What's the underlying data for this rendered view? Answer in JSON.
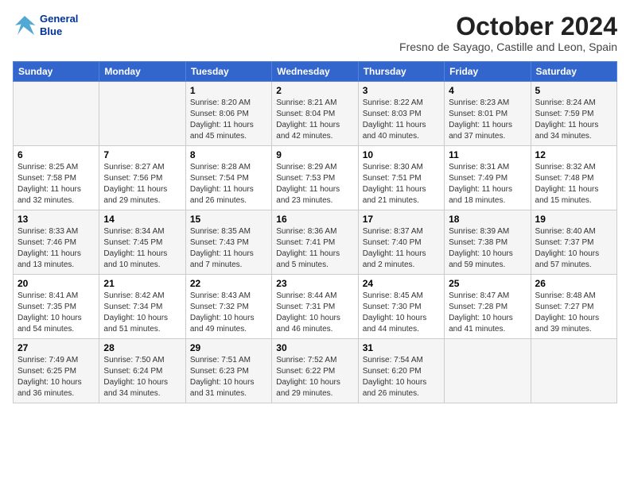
{
  "header": {
    "logo_line1": "General",
    "logo_line2": "Blue",
    "month_title": "October 2024",
    "subtitle": "Fresno de Sayago, Castille and Leon, Spain"
  },
  "days_of_week": [
    "Sunday",
    "Monday",
    "Tuesday",
    "Wednesday",
    "Thursday",
    "Friday",
    "Saturday"
  ],
  "weeks": [
    [
      {
        "day": "",
        "info": ""
      },
      {
        "day": "",
        "info": ""
      },
      {
        "day": "1",
        "info": "Sunrise: 8:20 AM\nSunset: 8:06 PM\nDaylight: 11 hours and 45 minutes."
      },
      {
        "day": "2",
        "info": "Sunrise: 8:21 AM\nSunset: 8:04 PM\nDaylight: 11 hours and 42 minutes."
      },
      {
        "day": "3",
        "info": "Sunrise: 8:22 AM\nSunset: 8:03 PM\nDaylight: 11 hours and 40 minutes."
      },
      {
        "day": "4",
        "info": "Sunrise: 8:23 AM\nSunset: 8:01 PM\nDaylight: 11 hours and 37 minutes."
      },
      {
        "day": "5",
        "info": "Sunrise: 8:24 AM\nSunset: 7:59 PM\nDaylight: 11 hours and 34 minutes."
      }
    ],
    [
      {
        "day": "6",
        "info": "Sunrise: 8:25 AM\nSunset: 7:58 PM\nDaylight: 11 hours and 32 minutes."
      },
      {
        "day": "7",
        "info": "Sunrise: 8:27 AM\nSunset: 7:56 PM\nDaylight: 11 hours and 29 minutes."
      },
      {
        "day": "8",
        "info": "Sunrise: 8:28 AM\nSunset: 7:54 PM\nDaylight: 11 hours and 26 minutes."
      },
      {
        "day": "9",
        "info": "Sunrise: 8:29 AM\nSunset: 7:53 PM\nDaylight: 11 hours and 23 minutes."
      },
      {
        "day": "10",
        "info": "Sunrise: 8:30 AM\nSunset: 7:51 PM\nDaylight: 11 hours and 21 minutes."
      },
      {
        "day": "11",
        "info": "Sunrise: 8:31 AM\nSunset: 7:49 PM\nDaylight: 11 hours and 18 minutes."
      },
      {
        "day": "12",
        "info": "Sunrise: 8:32 AM\nSunset: 7:48 PM\nDaylight: 11 hours and 15 minutes."
      }
    ],
    [
      {
        "day": "13",
        "info": "Sunrise: 8:33 AM\nSunset: 7:46 PM\nDaylight: 11 hours and 13 minutes."
      },
      {
        "day": "14",
        "info": "Sunrise: 8:34 AM\nSunset: 7:45 PM\nDaylight: 11 hours and 10 minutes."
      },
      {
        "day": "15",
        "info": "Sunrise: 8:35 AM\nSunset: 7:43 PM\nDaylight: 11 hours and 7 minutes."
      },
      {
        "day": "16",
        "info": "Sunrise: 8:36 AM\nSunset: 7:41 PM\nDaylight: 11 hours and 5 minutes."
      },
      {
        "day": "17",
        "info": "Sunrise: 8:37 AM\nSunset: 7:40 PM\nDaylight: 11 hours and 2 minutes."
      },
      {
        "day": "18",
        "info": "Sunrise: 8:39 AM\nSunset: 7:38 PM\nDaylight: 10 hours and 59 minutes."
      },
      {
        "day": "19",
        "info": "Sunrise: 8:40 AM\nSunset: 7:37 PM\nDaylight: 10 hours and 57 minutes."
      }
    ],
    [
      {
        "day": "20",
        "info": "Sunrise: 8:41 AM\nSunset: 7:35 PM\nDaylight: 10 hours and 54 minutes."
      },
      {
        "day": "21",
        "info": "Sunrise: 8:42 AM\nSunset: 7:34 PM\nDaylight: 10 hours and 51 minutes."
      },
      {
        "day": "22",
        "info": "Sunrise: 8:43 AM\nSunset: 7:32 PM\nDaylight: 10 hours and 49 minutes."
      },
      {
        "day": "23",
        "info": "Sunrise: 8:44 AM\nSunset: 7:31 PM\nDaylight: 10 hours and 46 minutes."
      },
      {
        "day": "24",
        "info": "Sunrise: 8:45 AM\nSunset: 7:30 PM\nDaylight: 10 hours and 44 minutes."
      },
      {
        "day": "25",
        "info": "Sunrise: 8:47 AM\nSunset: 7:28 PM\nDaylight: 10 hours and 41 minutes."
      },
      {
        "day": "26",
        "info": "Sunrise: 8:48 AM\nSunset: 7:27 PM\nDaylight: 10 hours and 39 minutes."
      }
    ],
    [
      {
        "day": "27",
        "info": "Sunrise: 7:49 AM\nSunset: 6:25 PM\nDaylight: 10 hours and 36 minutes."
      },
      {
        "day": "28",
        "info": "Sunrise: 7:50 AM\nSunset: 6:24 PM\nDaylight: 10 hours and 34 minutes."
      },
      {
        "day": "29",
        "info": "Sunrise: 7:51 AM\nSunset: 6:23 PM\nDaylight: 10 hours and 31 minutes."
      },
      {
        "day": "30",
        "info": "Sunrise: 7:52 AM\nSunset: 6:22 PM\nDaylight: 10 hours and 29 minutes."
      },
      {
        "day": "31",
        "info": "Sunrise: 7:54 AM\nSunset: 6:20 PM\nDaylight: 10 hours and 26 minutes."
      },
      {
        "day": "",
        "info": ""
      },
      {
        "day": "",
        "info": ""
      }
    ]
  ]
}
